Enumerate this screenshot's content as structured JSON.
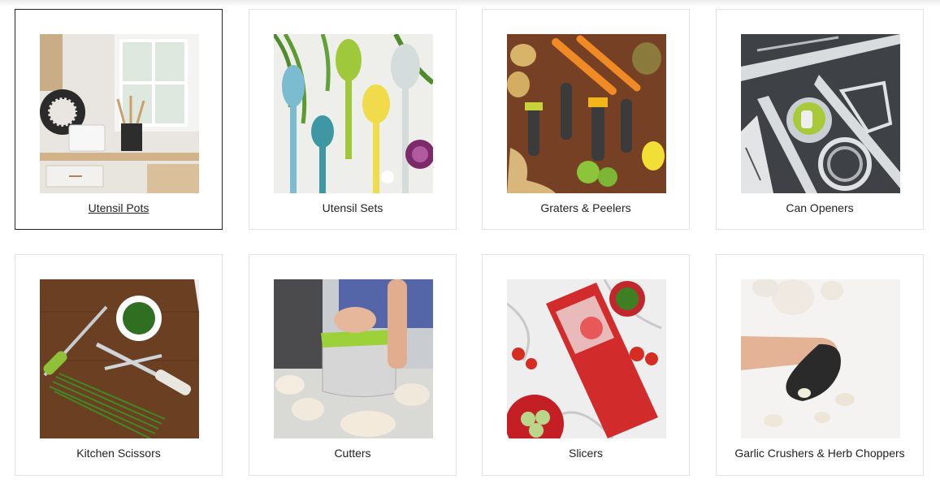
{
  "categories": [
    {
      "label": "Utensil Pots",
      "image": "utensil-pots-photo"
    },
    {
      "label": "Utensil Sets",
      "image": "utensil-sets-photo"
    },
    {
      "label": "Graters & Peelers",
      "image": "graters-peelers-photo"
    },
    {
      "label": "Can Openers",
      "image": "can-openers-photo"
    },
    {
      "label": "Kitchen Scissors",
      "image": "kitchen-scissors-photo"
    },
    {
      "label": "Cutters",
      "image": "cutters-photo"
    },
    {
      "label": "Slicers",
      "image": "slicers-photo"
    },
    {
      "label": "Garlic Crushers & Herb Choppers",
      "image": "garlic-crushers-photo"
    }
  ]
}
